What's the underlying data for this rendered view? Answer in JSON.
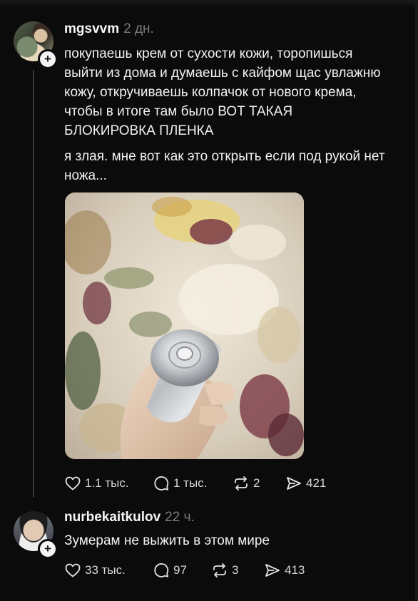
{
  "posts": [
    {
      "username": "mgsvvm",
      "time": "2 дн.",
      "text_1": "покупаешь крем от сухости кожи, торопишься выйти из дома и думаешь с кайфом щас увлажню кожу, откручиваешь колпачок от нового крема, чтобы в итоге там было ВОТ ТАКАЯ БЛОКИРОВКА ПЛЕНКА",
      "text_2": "я злая. мне вот как это открыть если под рукой нет ножа...",
      "stats": {
        "likes": "1.1 тыс.",
        "replies": "1 тыс.",
        "reposts": "2",
        "shares": "421"
      }
    },
    {
      "username": "nurbekaitkulov",
      "time": "22 ч.",
      "text_1": "Зумерам не выжить в этом мире",
      "stats": {
        "likes": "33 тыс.",
        "replies": "97",
        "reposts": "3",
        "shares": "413"
      }
    }
  ],
  "icons": {
    "like": "heart-icon",
    "reply": "comment-icon",
    "repost": "repost-icon",
    "share": "send-icon",
    "follow": "plus-icon"
  },
  "colors": {
    "background": "#0b0b0b",
    "text": "#f1f1f1",
    "muted": "#7a7a7a"
  }
}
